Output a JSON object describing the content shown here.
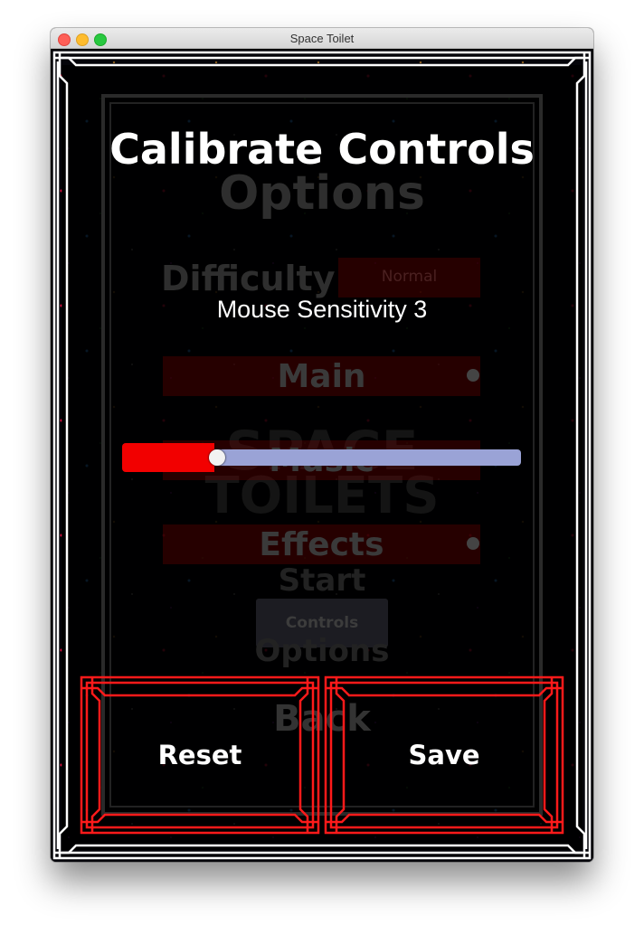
{
  "window": {
    "title": "Space Toilet"
  },
  "background_menu": {
    "title": "Options",
    "difficulty_label": "Difficulty",
    "difficulty_value": "Normal",
    "main_label": "Main",
    "music_label": "Music",
    "effects_label": "Effects",
    "start_label": "Start",
    "controls_label": "Controls",
    "options_label": "Options",
    "back_label": "Back",
    "space_logo": "SPACE",
    "toilets_logo": "TOILETS"
  },
  "overlay": {
    "title": "Calibrate Controls",
    "sensitivity_label": "Mouse Sensitivity 3",
    "sensitivity_fraction": 0.23
  },
  "buttons": {
    "reset_label": "Reset",
    "save_label": "Save"
  },
  "colors": {
    "accent_red": "#f20000",
    "track": "#9aa3d6",
    "frame_red": "#ff1a1a"
  }
}
